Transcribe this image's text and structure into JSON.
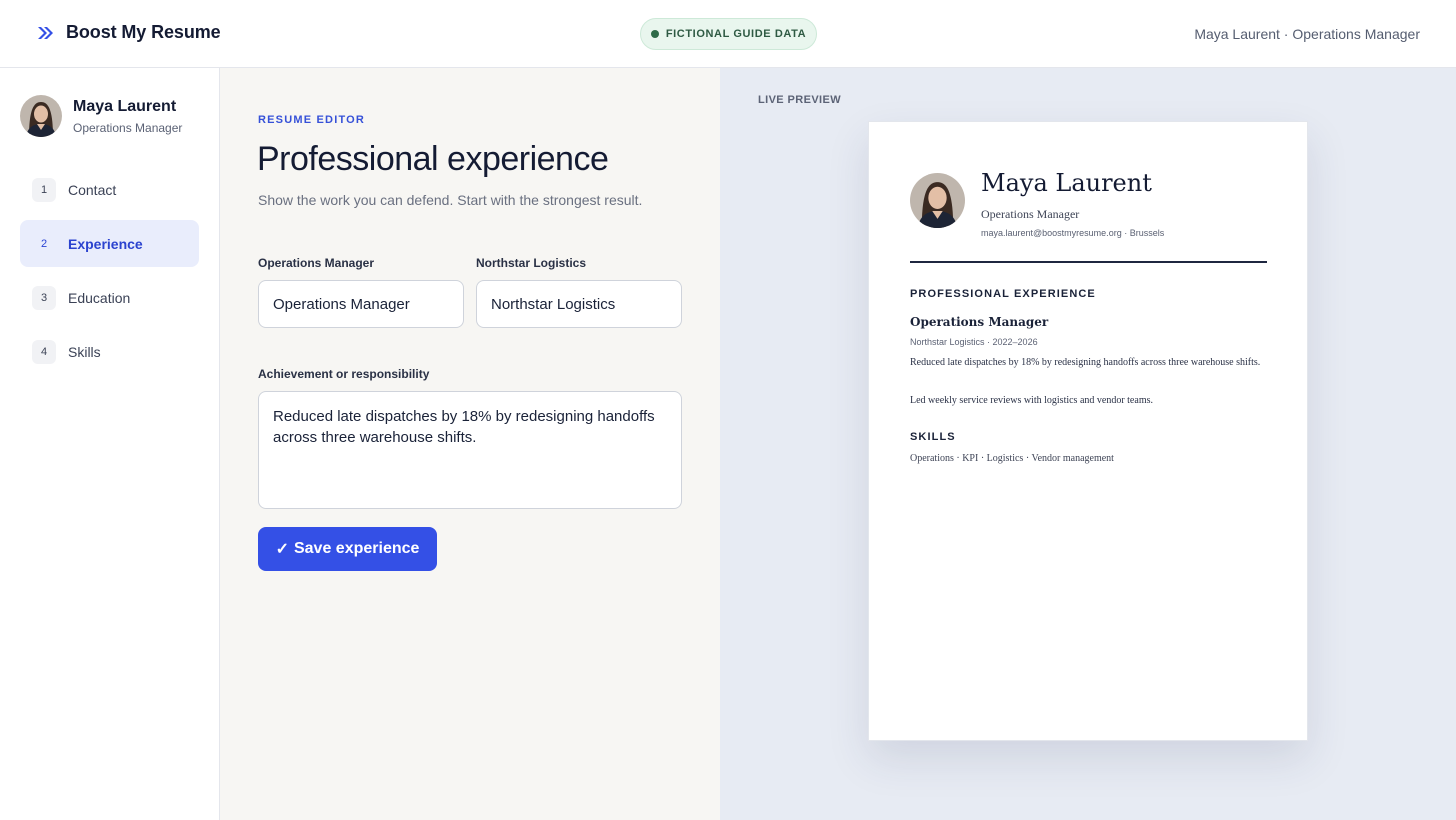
{
  "header": {
    "brand": "Boost My Resume",
    "badge": "FICTIONAL GUIDE DATA",
    "user_info": "Maya Laurent · Operations Manager",
    "colors": {
      "accent": "#3450e6",
      "badge_bg": "#e9f6ee",
      "badge_text": "#2e5a43"
    }
  },
  "sidebar": {
    "profile": {
      "name": "Maya Laurent",
      "role": "Operations Manager"
    },
    "items": [
      {
        "num": "1",
        "label": "Contact"
      },
      {
        "num": "2",
        "label": "Experience"
      },
      {
        "num": "3",
        "label": "Education"
      },
      {
        "num": "4",
        "label": "Skills"
      }
    ],
    "active_item": "Experience"
  },
  "editor": {
    "eyebrow": "RESUME EDITOR",
    "title": "Professional experience",
    "subtitle": "Show the work you can defend. Start with the strongest result.",
    "fields": {
      "role_label": "Operations Manager",
      "role_value": "Operations Manager",
      "company_label": "Northstar Logistics",
      "company_value": "Northstar Logistics",
      "achievement_label": "Achievement or responsibility",
      "achievement_value": "Reduced late dispatches by 18% by redesigning handoffs across three warehouse shifts."
    },
    "save_icon": "✓",
    "save_label": "Save experience"
  },
  "preview": {
    "label": "LIVE PREVIEW",
    "resume": {
      "name": "Maya Laurent",
      "role": "Operations Manager",
      "contact": "maya.laurent@boostmyresume.org · Brussels",
      "experience_heading": "PROFESSIONAL EXPERIENCE",
      "job_title": "Operations Manager",
      "job_meta": "Northstar Logistics · 2022–2026",
      "bullets": [
        "Reduced late dispatches by 18% by redesigning handoffs across three warehouse shifts.",
        "Led weekly service reviews with logistics and vendor teams."
      ],
      "skills_heading": "SKILLS",
      "skills": "Operations · KPI · Logistics · Vendor management"
    }
  }
}
